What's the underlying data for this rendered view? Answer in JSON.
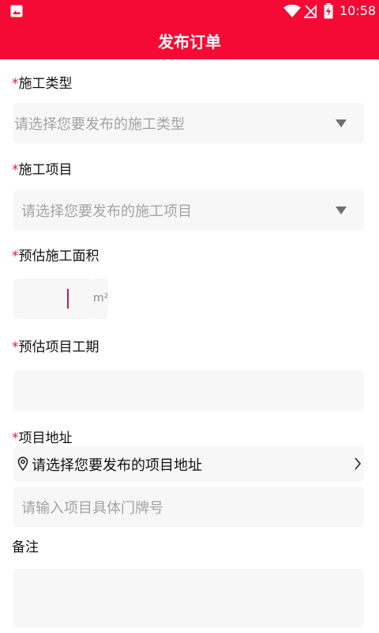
{
  "status_bar": {
    "time": "10:58"
  },
  "header": {
    "title": "发布订单"
  },
  "form": {
    "required_mark": "*",
    "construction_type": {
      "label": "施工类型",
      "placeholder": "请选择您要发布的施工类型"
    },
    "construction_item": {
      "label": "施工项目",
      "placeholder": "请选择您要发布的施工项目"
    },
    "estimated_area": {
      "label": "预估施工面积",
      "unit": "m²"
    },
    "estimated_period": {
      "label": "预估项目工期"
    },
    "project_address": {
      "label": "项目地址",
      "select_text": "请选择您要发布的项目地址",
      "detail_placeholder": "请输入项目具体门牌号"
    },
    "remarks": {
      "label": "备注"
    }
  },
  "colors": {
    "brand": "#f50a35",
    "required": "#e8163a",
    "field_bg": "#f7f7f7",
    "placeholder": "#a3a3a3"
  },
  "icons": [
    "gallery-icon",
    "wifi-icon",
    "no-sim-icon",
    "battery-charging-icon",
    "location-pin-icon",
    "chevron-right-icon",
    "dropdown-caret-icon"
  ]
}
